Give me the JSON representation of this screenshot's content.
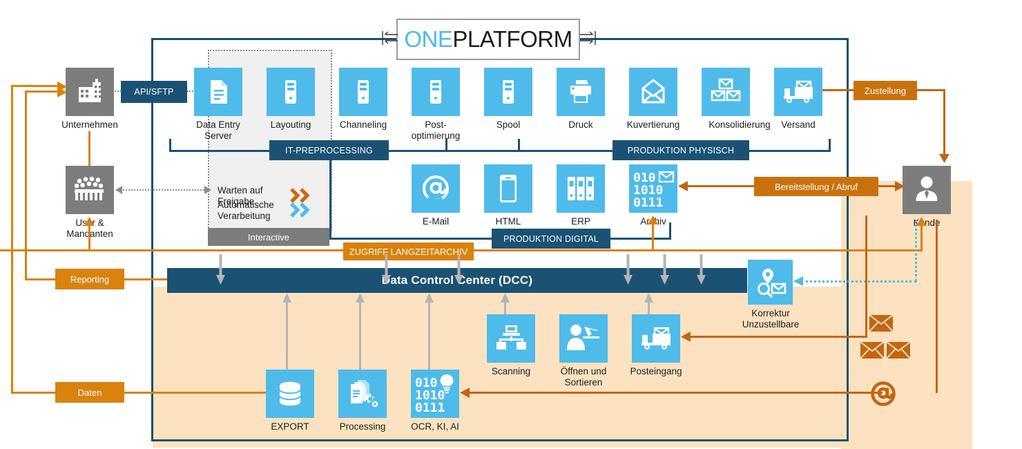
{
  "title": {
    "part1": "ONE",
    "part2": "PLATFORM"
  },
  "actors": {
    "unternehmen": "Unternehmen",
    "user_mandanten": "User &\nMandanten",
    "user_mandanten_l1": "User &",
    "user_mandanten_l2": "Mandanten",
    "kunde": "Kunde"
  },
  "connectors": {
    "api_sftp": "API/SFTP",
    "zustellung": "Zustellung",
    "bereitstellung": "Bereitstellung / Abruf",
    "reporting": "Reporting",
    "daten": "Daten",
    "zugriff_langzeitarchiv": "ZUGRIFF LANGZEITARCHIV"
  },
  "bands": {
    "it_preprocessing": "IT-PREPROCESSING",
    "produktion_physisch": "PRODUKTION PHYSISCH",
    "produktion_digital": "PRODUKTION DIGITAL",
    "dcc": "Data Control Center (DCC)"
  },
  "interactive_panel": {
    "rows": [
      {
        "label_l1": "Warten auf",
        "label_l2": "Freigabe",
        "chevron_color": "#cc6a0c"
      },
      {
        "label_l1": "Automatische",
        "label_l2": "Verarbeitung",
        "chevron_color": "#4fbbea"
      }
    ],
    "footer": "Interactive"
  },
  "top_row": [
    {
      "label_l1": "Data Entry",
      "label_l2": "Server",
      "icon": "document-icon"
    },
    {
      "label_l1": "Layouting",
      "label_l2": "",
      "icon": "server-tower-icon"
    },
    {
      "label_l1": "Channeling",
      "label_l2": "",
      "icon": "server-tower-icon"
    },
    {
      "label_l1": "Post-",
      "label_l2": "optimierung",
      "icon": "server-tower-icon"
    },
    {
      "label_l1": "Spool",
      "label_l2": "",
      "icon": "server-tower-icon"
    },
    {
      "label_l1": "Druck",
      "label_l2": "",
      "icon": "printer-icon"
    },
    {
      "label_l1": "Kuvertierung",
      "label_l2": "",
      "icon": "envelope-open-icon"
    },
    {
      "label_l1": "Konsolidierung",
      "label_l2": "",
      "icon": "multi-envelope-icon"
    },
    {
      "label_l1": "Versand",
      "label_l2": "",
      "icon": "truck-mail-icon"
    }
  ],
  "digital_row": [
    {
      "label_l1": "E-Mail",
      "label_l2": "",
      "icon": "at-sign-icon"
    },
    {
      "label_l1": "HTML",
      "label_l2": "",
      "icon": "smartphone-icon"
    },
    {
      "label_l1": "ERP",
      "label_l2": "",
      "icon": "binders-icon"
    },
    {
      "label_l1": "Archiv",
      "label_l2": "",
      "icon": "binary-mail-icon",
      "binary": [
        "010",
        "1010",
        "0111"
      ]
    }
  ],
  "inbound_row": [
    {
      "label_l1": "Scanning",
      "label_l2": "",
      "icon": "scanner-network-icon"
    },
    {
      "label_l1": "Öffnen und",
      "label_l2": "Sortieren",
      "icon": "open-sort-mail-icon"
    },
    {
      "label_l1": "Posteingang",
      "label_l2": "",
      "icon": "truck-mail-icon"
    }
  ],
  "bottom_row": [
    {
      "label_l1": "EXPORT",
      "label_l2": "",
      "icon": "database-icon"
    },
    {
      "label_l1": "Processing",
      "label_l2": "",
      "icon": "documents-gears-icon"
    },
    {
      "label_l1": "OCR, KI, AI",
      "label_l2": "",
      "icon": "binary-bulb-icon",
      "binary": [
        "010",
        "1010",
        "0111"
      ]
    }
  ],
  "korrektur": {
    "label_l1": "Korrektur",
    "label_l2": "Unzustellbare",
    "icon": "pin-search-mail-icon"
  },
  "return_icons": [
    {
      "icon": "envelope-icon"
    },
    {
      "icon": "envelope-icon"
    },
    {
      "icon": "envelope-icon"
    },
    {
      "icon": "at-sign-icon"
    }
  ],
  "colors": {
    "navy": "#1b5274",
    "navy_frame": "#17516f",
    "light_blue": "#4fbbea",
    "orange": "#d9820e",
    "dark_orange": "#c26512",
    "gray": "#7d7d7d",
    "beige": "#fce2c0",
    "panel_gray": "#f0f0f0"
  }
}
